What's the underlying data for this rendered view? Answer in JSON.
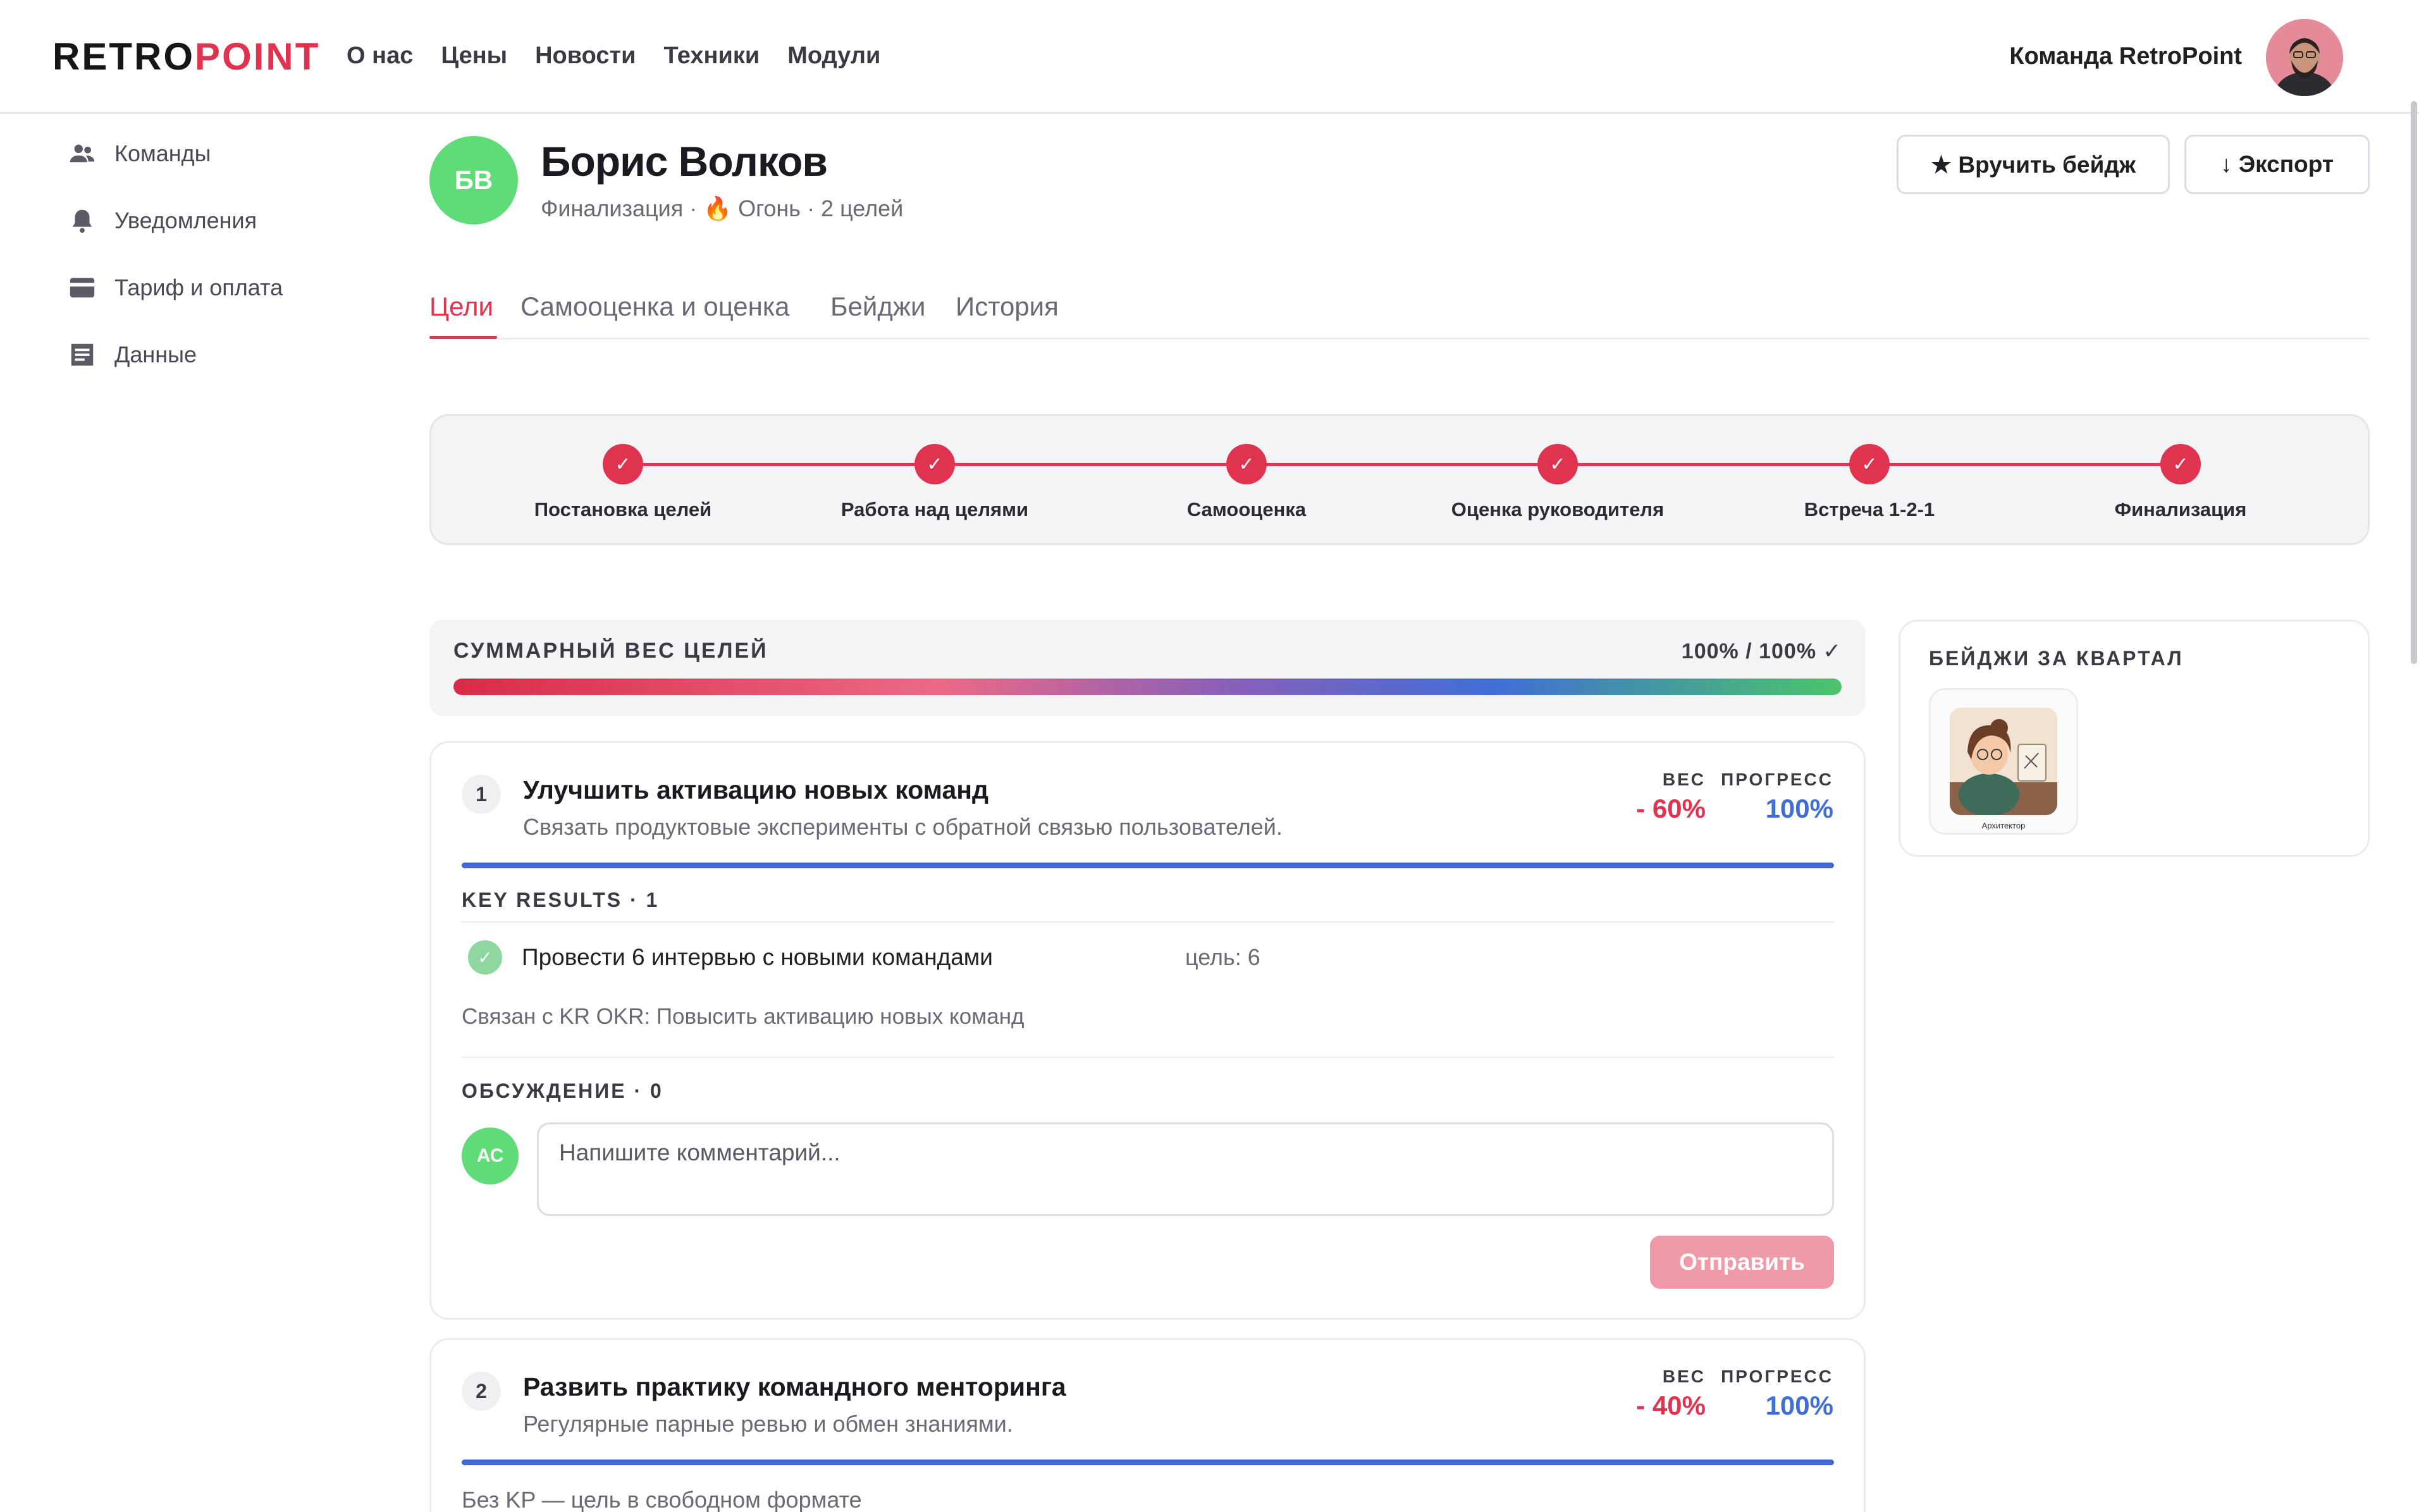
{
  "brand": {
    "logo_part1": "RETRO",
    "logo_part2": "POINT",
    "accent": "#e0334f"
  },
  "topnav": [
    "О нас",
    "Цены",
    "Новости",
    "Техники",
    "Модули"
  ],
  "account": {
    "team_name": "Команда RetroPoint"
  },
  "sidebar": {
    "items": [
      {
        "label": "Команды",
        "icon": "people-icon"
      },
      {
        "label": "Уведомления",
        "icon": "bell-icon"
      },
      {
        "label": "Тариф и оплата",
        "icon": "credit-card-icon"
      },
      {
        "label": "Данные",
        "icon": "document-icon"
      }
    ]
  },
  "profile": {
    "initials": "БВ",
    "name": "Борис Волков",
    "meta": "Финализация · 🔥 Огонь · 2 целей",
    "award_badge_label": "★ Вручить бейдж",
    "export_label": "↓ Экспорт"
  },
  "tabs": [
    "Цели",
    "Самооценка и оценка",
    "Бейджи",
    "История"
  ],
  "active_tab": "Цели",
  "stepper": {
    "completed": 6,
    "steps": [
      "Постановка целей",
      "Работа над целями",
      "Самооценка",
      "Оценка руководителя",
      "Встреча 1-2-1",
      "Финализация"
    ]
  },
  "weight_summary": {
    "title": "СУММАРНЫЙ ВЕС ЦЕЛЕЙ",
    "value_text": "100% / 100% ✓",
    "fill_fraction": 1.0
  },
  "badges_panel": {
    "title": "БЕЙДЖИ ЗА КВАРТАЛ",
    "badges": [
      {
        "caption": "Архитектор"
      }
    ]
  },
  "goals": [
    {
      "number": "1",
      "title": "Улучшить активацию новых команд",
      "description": "Связать продуктовые эксперименты с обратной связью пользователей.",
      "weight_label": "ВЕС",
      "weight": "- 60%",
      "progress_label": "ПРОГРЕСС",
      "progress": "100%",
      "progress_fraction": 1.0,
      "key_results_header": "KEY RESULTS · 1",
      "key_results": [
        {
          "text": "Провести 6 интервью с новыми командами",
          "target": "цель: 6",
          "done": true
        }
      ],
      "okr_link": "Связан с KR OKR: Повысить активацию новых команд",
      "discussion_header": "ОБСУЖДЕНИЕ · 0",
      "commenter_initials": "АС",
      "comment_placeholder": "Напишите комментарий...",
      "send_label": "Отправить"
    },
    {
      "number": "2",
      "title": "Развить практику командного менторинга",
      "description": "Регулярные парные ревью и обмен знаниями.",
      "weight_label": "ВЕС",
      "weight": "- 40%",
      "progress_label": "ПРОГРЕСС",
      "progress": "100%",
      "progress_fraction": 1.0,
      "note": "Без KP — цель в свободном формате"
    }
  ]
}
